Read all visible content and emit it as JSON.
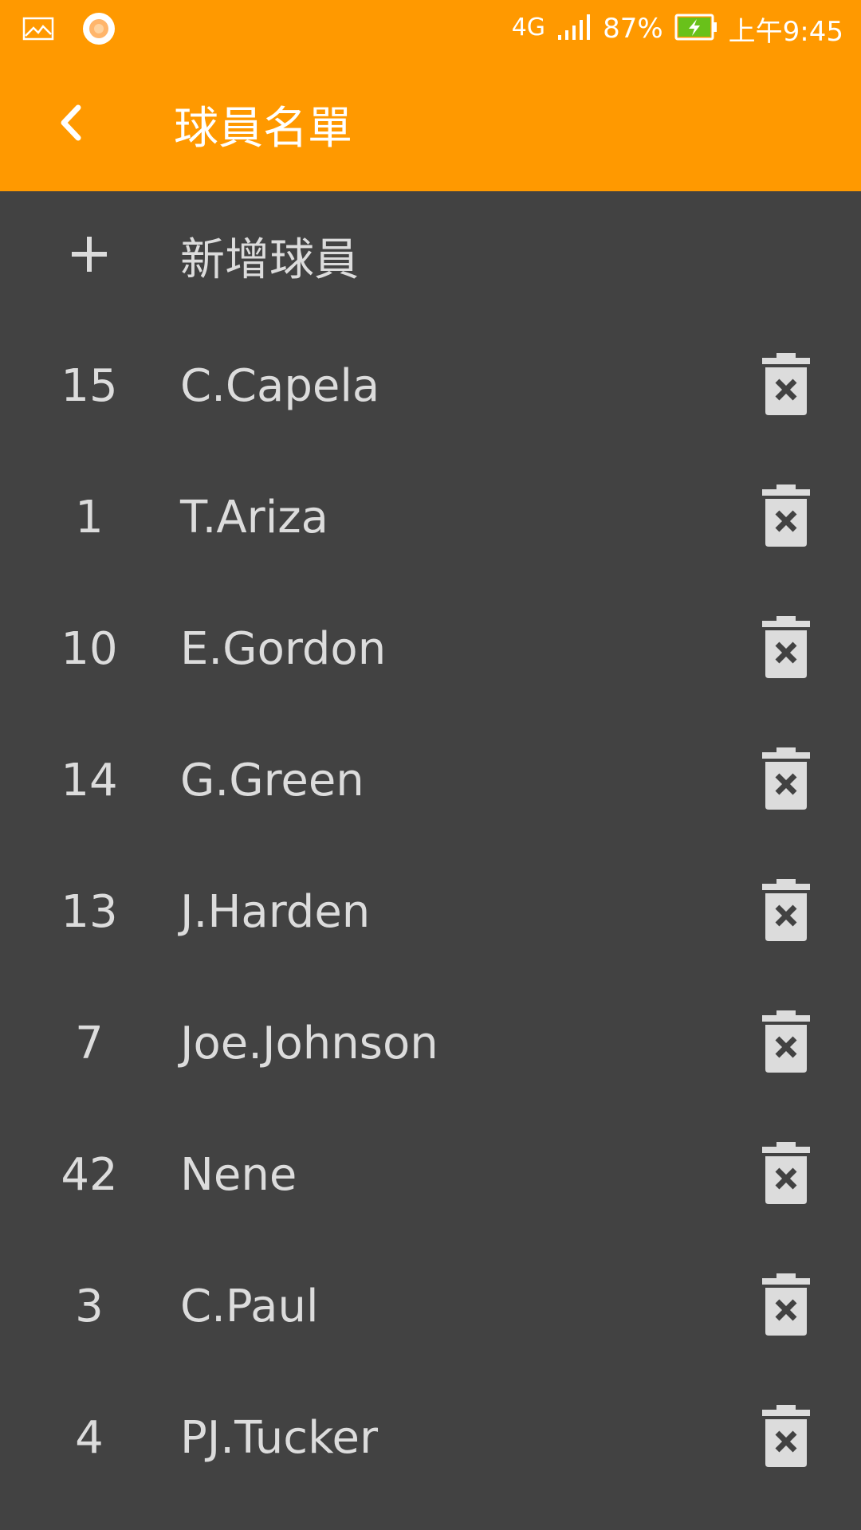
{
  "status_bar": {
    "network": "4G",
    "battery_percent": "87%",
    "time": "上午9:45",
    "icons": [
      "gallery-icon",
      "notification-dot-icon",
      "signal-icon",
      "battery-charging-icon"
    ],
    "battery_color": "#69c11a"
  },
  "app_bar": {
    "title": "球員名單",
    "background": "#ff9900"
  },
  "add_player": {
    "label": "新增球員"
  },
  "players": [
    {
      "number": "15",
      "name": "C.Capela"
    },
    {
      "number": "1",
      "name": "T.Ariza"
    },
    {
      "number": "10",
      "name": "E.Gordon"
    },
    {
      "number": "14",
      "name": "G.Green"
    },
    {
      "number": "13",
      "name": "J.Harden"
    },
    {
      "number": "7",
      "name": "Joe.Johnson"
    },
    {
      "number": "42",
      "name": "Nene"
    },
    {
      "number": "3",
      "name": "C.Paul"
    },
    {
      "number": "4",
      "name": "PJ.Tucker"
    }
  ]
}
